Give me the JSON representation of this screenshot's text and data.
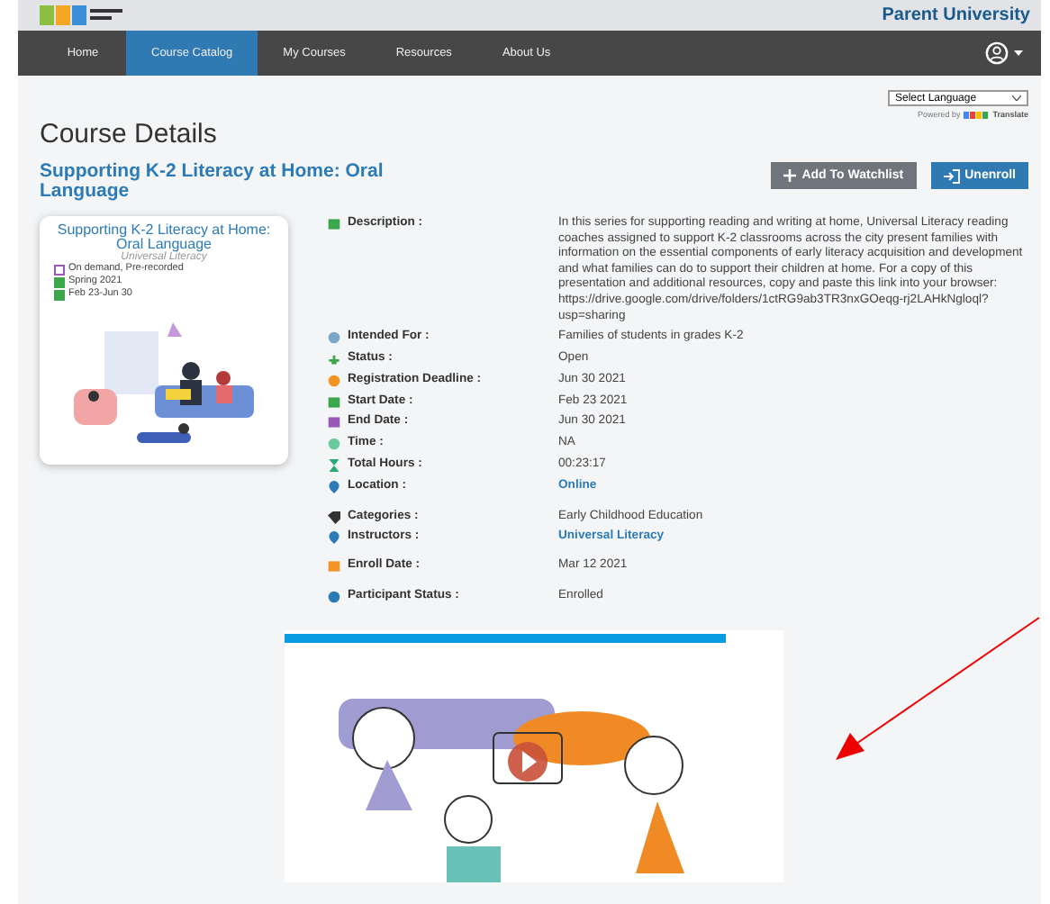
{
  "header": {
    "title": "Parent University"
  },
  "nav": [
    {
      "label": "Home",
      "selected": false
    },
    {
      "label": "Course Catalog",
      "selected": true
    },
    {
      "label": "My Courses",
      "selected": false
    },
    {
      "label": "Resources",
      "selected": false
    },
    {
      "label": "About Us",
      "selected": false
    }
  ],
  "language": {
    "value": "Select Language",
    "powered_by": "Powered by",
    "translate": "Translate"
  },
  "page_title": "Course Details",
  "course_title": "Supporting K-2 Literacy at Home: Oral Language",
  "buttons": [
    {
      "label": "Add To Watchlist",
      "kind": "watchlist"
    },
    {
      "label": "Unenroll",
      "kind": "unenroll"
    }
  ],
  "card": {
    "title": "Supporting K-2 Literacy at Home: Oral Language",
    "provider": "Universal Literacy",
    "meta": [
      "On demand, Pre-recorded",
      "Spring 2021",
      "Feb 23-Jun 30"
    ]
  },
  "details": [
    {
      "label": "Description :",
      "value": "In this series for supporting reading and writing at home, Universal Literacy reading coaches assigned to support K-2 classrooms across the city present families with information on the essential components of early literacy acquisition and development and what families can do to support their children at home. For a copy of this presentation and additional resources, copy and paste this link into your browser: https://drive.google.com/drive/folders/1ctRG9ab3TR3nxGOeqg-rj2LAHkNgloql?usp=sharing",
      "link": false
    },
    {
      "label": "Intended For :",
      "value": "Families of students in grades K-2",
      "link": false
    },
    {
      "label": "Status :",
      "value": "Open",
      "link": false
    },
    {
      "label": "Registration Deadline :",
      "value": "Jun 30 2021",
      "link": false
    },
    {
      "label": "Start Date :",
      "value": "Feb 23 2021",
      "link": false
    },
    {
      "label": "End Date :",
      "value": "Jun 30 2021",
      "link": false
    },
    {
      "label": "Time :",
      "value": "NA",
      "link": false
    },
    {
      "label": "Total Hours :",
      "value": "00:23:17",
      "link": false
    },
    {
      "label": "Location :",
      "value": "Online",
      "link": true
    },
    {
      "label": "Categories :",
      "value": "Early Childhood Education",
      "link": false
    },
    {
      "label": "Instructors :",
      "value": "Universal Literacy",
      "link": true
    },
    {
      "label": "Enroll Date :",
      "value": "Mar 12 2021",
      "link": false
    },
    {
      "label": "Participant Status :",
      "value": "Enrolled",
      "link": false
    }
  ]
}
